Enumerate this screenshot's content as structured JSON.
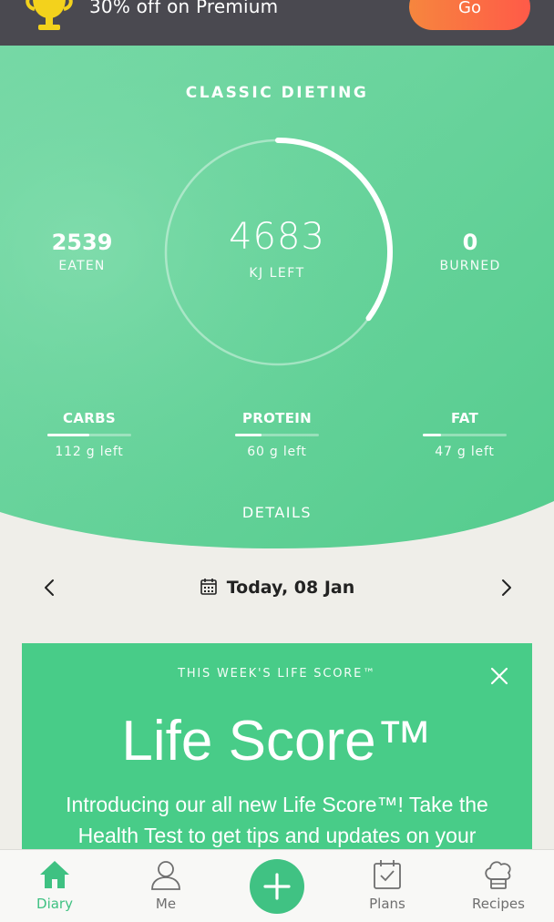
{
  "promo": {
    "text": "30% off on Premium",
    "button": "Go"
  },
  "dashboard": {
    "title": "CLASSIC DIETING",
    "eaten": {
      "value": "2539",
      "label": "EATEN"
    },
    "left": {
      "value": "4683",
      "label": "KJ LEFT"
    },
    "burned": {
      "value": "0",
      "label": "BURNED"
    },
    "ring_progress": 0.35,
    "macros": [
      {
        "name": "CARBS",
        "left": "112 g left",
        "progress": 0.5
      },
      {
        "name": "PROTEIN",
        "left": "60 g left",
        "progress": 0.32
      },
      {
        "name": "FAT",
        "left": "47 g left",
        "progress": 0.22
      }
    ],
    "details": "DETAILS"
  },
  "date_nav": {
    "label": "Today, 08 Jan"
  },
  "life_score_card": {
    "eyebrow": "THIS WEEK'S LIFE SCORE™",
    "headline": "Life Score™",
    "body": "Introducing our all new Life Score™! Take the Health Test to get tips and updates on your"
  },
  "tabbar": {
    "items": [
      {
        "label": "Diary",
        "icon": "home-icon",
        "active": true
      },
      {
        "label": "Me",
        "icon": "person-icon",
        "active": false
      },
      {
        "label": "",
        "icon": "plus-icon",
        "active": false
      },
      {
        "label": "Plans",
        "icon": "calendar-check-icon",
        "active": false
      },
      {
        "label": "Recipes",
        "icon": "chef-hat-icon",
        "active": false
      }
    ]
  },
  "colors": {
    "green": "#48cc88",
    "accent": "#40c283",
    "promo_bg": "#4a4950",
    "go_gradient_start": "#f6863e",
    "go_gradient_end": "#ff5a48"
  }
}
